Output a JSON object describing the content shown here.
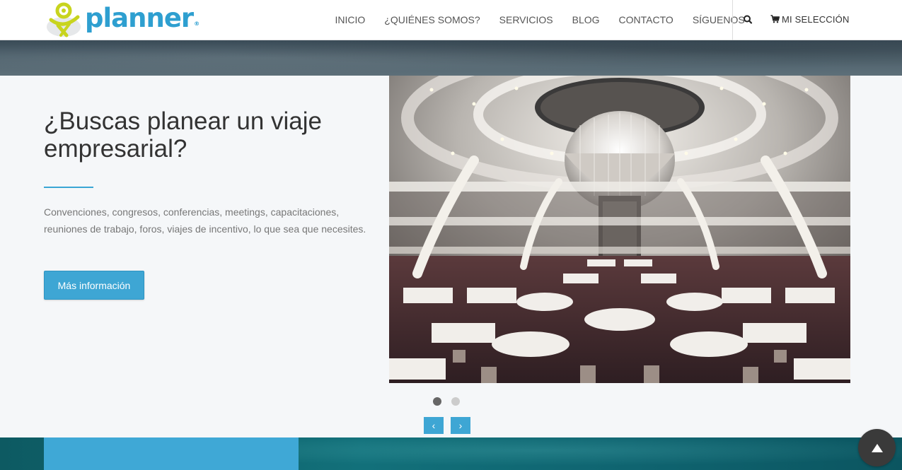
{
  "header": {
    "logo_text": "planner",
    "logo_mark": "®",
    "nav": [
      {
        "label": "INICIO"
      },
      {
        "label": "¿QUIÉNES SOMOS?"
      },
      {
        "label": "SERVICIOS"
      },
      {
        "label": "BLOG"
      },
      {
        "label": "CONTACTO"
      },
      {
        "label": "SÍGUENOS"
      }
    ],
    "search_icon": "search-icon",
    "cart_label": "MI SELECCIÓN",
    "cart_icon": "cart-icon"
  },
  "hero": {
    "title": "¿Buscas planear un viaje empresarial?",
    "description": "Convenciones, congresos, conferencias, meetings, capacitaciones, reuniones de trabajo, foros, viajes de incentivo, lo que sea que necesites.",
    "button_label": "Más información"
  },
  "carousel": {
    "slides_count": 2,
    "active_index": 0,
    "prev_label": "‹",
    "next_label": "›"
  },
  "colors": {
    "accent": "#3ea6d4",
    "logo_blue": "#2e9fd0",
    "logo_yellow": "#d8dc2a"
  }
}
